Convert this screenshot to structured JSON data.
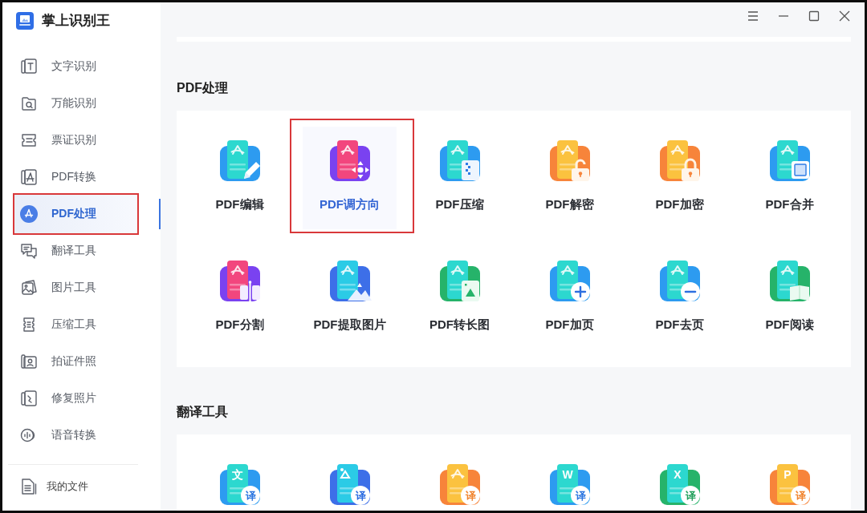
{
  "app": {
    "title": "掌上识别王"
  },
  "sidebar": {
    "items": [
      {
        "kind": "text",
        "label": "文字识别",
        "selected": false
      },
      {
        "kind": "search",
        "label": "万能识别",
        "selected": false
      },
      {
        "kind": "ticket",
        "label": "票证识别",
        "selected": false
      },
      {
        "kind": "pdf",
        "label": "PDF转换",
        "selected": false
      },
      {
        "kind": "pdf-tools",
        "label": "PDF处理",
        "selected": true
      },
      {
        "kind": "translate",
        "label": "翻译工具",
        "selected": false
      },
      {
        "kind": "image",
        "label": "图片工具",
        "selected": false
      },
      {
        "kind": "compress",
        "label": "压缩工具",
        "selected": false
      },
      {
        "kind": "id-photo",
        "label": "拍证件照",
        "selected": false
      },
      {
        "kind": "repair",
        "label": "修复照片",
        "selected": false
      },
      {
        "kind": "voice",
        "label": "语音转换",
        "selected": false
      }
    ],
    "footer": {
      "kind": "file",
      "label": "我的文件"
    }
  },
  "sections": [
    {
      "title": "PDF处理",
      "items": [
        {
          "kind": "edit",
          "label": "PDF编辑",
          "selected": false
        },
        {
          "kind": "rotate",
          "label": "PDF调方向",
          "selected": true
        },
        {
          "kind": "compress",
          "label": "PDF压缩",
          "selected": false
        },
        {
          "kind": "decrypt",
          "label": "PDF解密",
          "selected": false
        },
        {
          "kind": "encrypt",
          "label": "PDF加密",
          "selected": false
        },
        {
          "kind": "merge",
          "label": "PDF合并",
          "selected": false
        },
        {
          "kind": "split",
          "label": "PDF分割",
          "selected": false
        },
        {
          "kind": "extract-image",
          "label": "PDF提取图片",
          "selected": false
        },
        {
          "kind": "long-image",
          "label": "PDF转长图",
          "selected": false
        },
        {
          "kind": "add-page",
          "label": "PDF加页",
          "selected": false
        },
        {
          "kind": "remove-page",
          "label": "PDF去页",
          "selected": false
        },
        {
          "kind": "read",
          "label": "PDF阅读",
          "selected": false
        }
      ]
    },
    {
      "title": "翻译工具",
      "items": [
        {
          "kind": "translate-text",
          "glyph": "文",
          "badge": "译"
        },
        {
          "kind": "translate-image",
          "badge": "译"
        },
        {
          "kind": "translate-pdf",
          "badge": "译"
        },
        {
          "kind": "translate-word",
          "glyph": "W",
          "badge": "译"
        },
        {
          "kind": "translate-excel",
          "glyph": "X",
          "badge": "译"
        },
        {
          "kind": "translate-ppt",
          "glyph": "P",
          "badge": "译"
        }
      ]
    }
  ]
}
